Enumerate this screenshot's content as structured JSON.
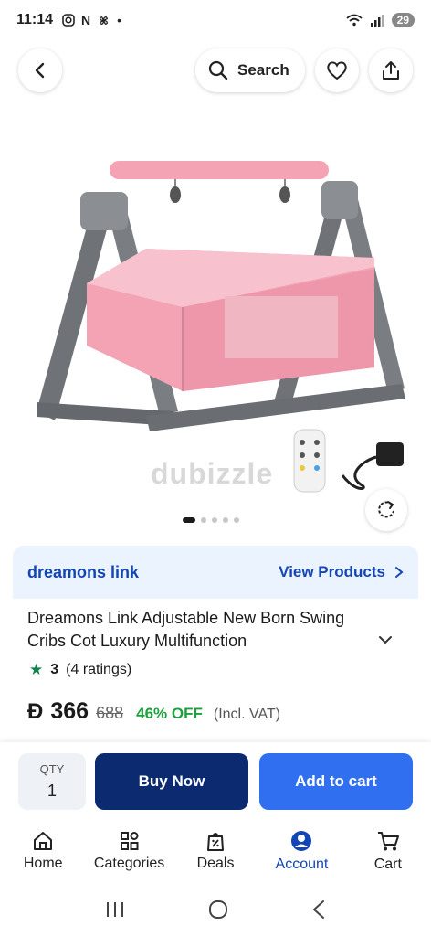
{
  "status_bar": {
    "time": "11:14",
    "icons": [
      "instagram-icon",
      "n-icon",
      "pinwheel-icon",
      "dot-icon"
    ],
    "battery": "29"
  },
  "top_bar": {
    "back_icon": "back-icon",
    "search_label": "Search",
    "favorite_icon": "heart-icon",
    "share_icon": "share-icon"
  },
  "gallery": {
    "watermark": "dubizzle",
    "image_count": 5,
    "active_index": 0
  },
  "seller": {
    "name": "dreamons link",
    "link": "View Products"
  },
  "product": {
    "title": "Dreamons Link Adjustable New Born Swing Cribs Cot Luxury Multifunction",
    "rating": "3",
    "ratings_count": "(4 ratings)",
    "currency_symbol": "Đ",
    "price": "366",
    "old_price": "688",
    "discount": "46% OFF",
    "vat_note": "(Incl. VAT)"
  },
  "purchase": {
    "qty_label": "QTY",
    "qty_value": "1",
    "buy_now": "Buy Now",
    "add_to_cart": "Add to cart"
  },
  "bottom_nav": [
    {
      "label": "Home",
      "icon": "home-icon"
    },
    {
      "label": "Categories",
      "icon": "categories-icon"
    },
    {
      "label": "Deals",
      "icon": "deals-icon"
    },
    {
      "label": "Account",
      "icon": "account-icon",
      "active": true
    },
    {
      "label": "Cart",
      "icon": "cart-icon"
    }
  ],
  "colors": {
    "brand_blue": "#1446b3",
    "dark_navy": "#0b2a6f",
    "cart_blue": "#2f6ff0",
    "discount_green": "#1e9f3f",
    "crib_pink": "#f3a3b4"
  }
}
